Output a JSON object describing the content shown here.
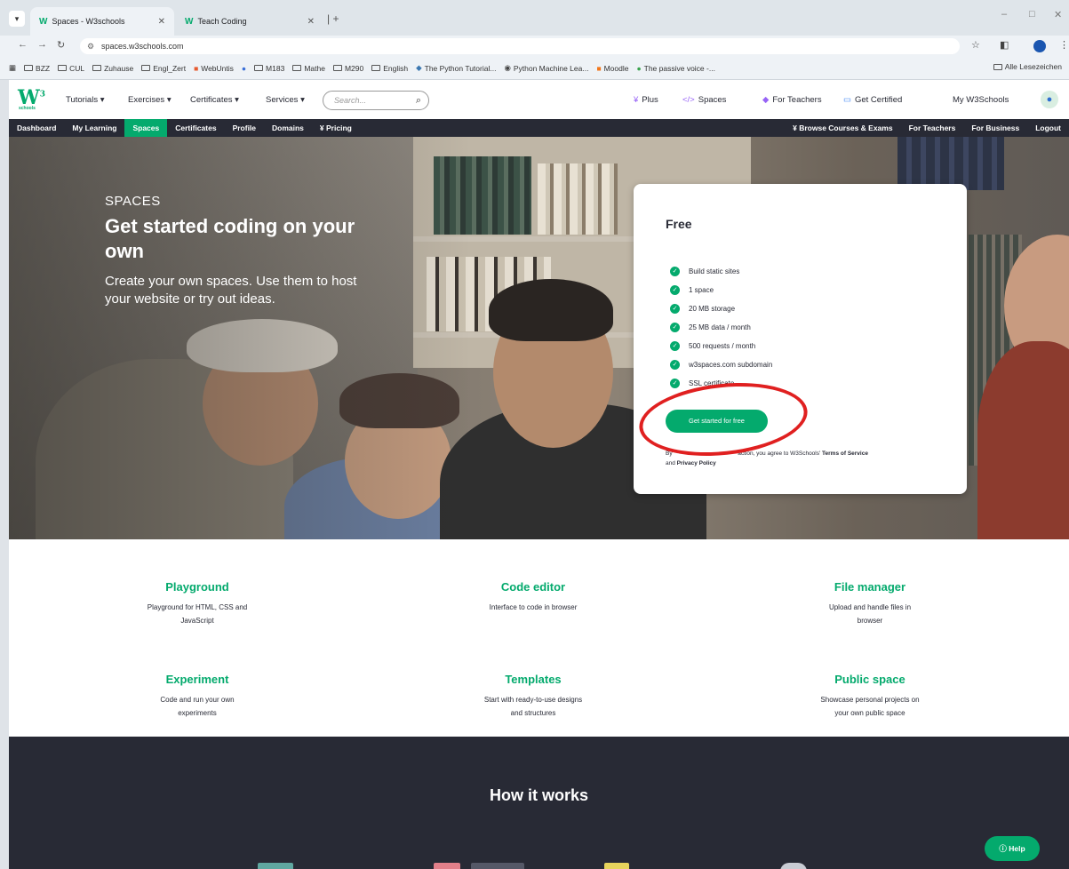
{
  "browser": {
    "tabs": [
      {
        "label": "Spaces - W3schools",
        "favicon": "W"
      },
      {
        "label": "Teach Coding",
        "favicon": "W"
      }
    ],
    "url": "spaces.w3schools.com",
    "bookmarks": [
      "BZZ",
      "CUL",
      "Zuhause",
      "Engl_Zert",
      "WebUntis",
      "M183",
      "Mathe",
      "M290",
      "English",
      "The Python Tutorial...",
      "Python Machine Lea...",
      "Moodle",
      "The passive voice -..."
    ],
    "bookmarks_right": "Alle Lesezeichen"
  },
  "topnav": {
    "logo": "W",
    "logo_sub": "schools",
    "items": [
      "Tutorials ▾",
      "Exercises ▾",
      "Certificates ▾",
      "Services ▾"
    ],
    "search_placeholder": "Search...",
    "right": [
      "Plus",
      "Spaces",
      "For Teachers",
      "Get Certified",
      "My W3Schools"
    ]
  },
  "subnav": {
    "left": [
      "Dashboard",
      "My Learning",
      "Spaces",
      "Certificates",
      "Profile",
      "Domains",
      "Pricing"
    ],
    "right": [
      "Browse Courses & Exams",
      "For Teachers",
      "For Business",
      "Logout"
    ]
  },
  "hero": {
    "kicker": "SPACES",
    "title": "Get started coding on your own",
    "subtitle": "Create your own spaces. Use them to host your website or try out ideas."
  },
  "card": {
    "title": "Free",
    "features": [
      "Build static sites",
      "1 space",
      "20 MB storage",
      "25 MB data / month",
      "500 requests / month",
      "w3spaces.com subdomain",
      "SSL certificate"
    ],
    "cta": "Get started for free",
    "terms_prefix": "By",
    "terms_mid": "action, you agree to W3Schools'",
    "terms_link1": "Terms of Service",
    "terms_and": "and",
    "terms_link2": "Privacy Policy"
  },
  "features": [
    {
      "title": "Playground",
      "desc": "Playground for HTML, CSS and JavaScript"
    },
    {
      "title": "Code editor",
      "desc": "Interface to code in browser"
    },
    {
      "title": "File manager",
      "desc": "Upload and handle files in browser"
    },
    {
      "title": "Experiment",
      "desc": "Code and run your own experiments"
    },
    {
      "title": "Templates",
      "desc": "Start with ready-to-use designs and structures"
    },
    {
      "title": "Public space",
      "desc": "Showcase personal projects on your own public space"
    }
  ],
  "how": {
    "title": "How it works"
  },
  "help": "Help",
  "colors": {
    "accent": "#04aa6d",
    "dark": "#282a35",
    "annotation": "#e02020"
  }
}
